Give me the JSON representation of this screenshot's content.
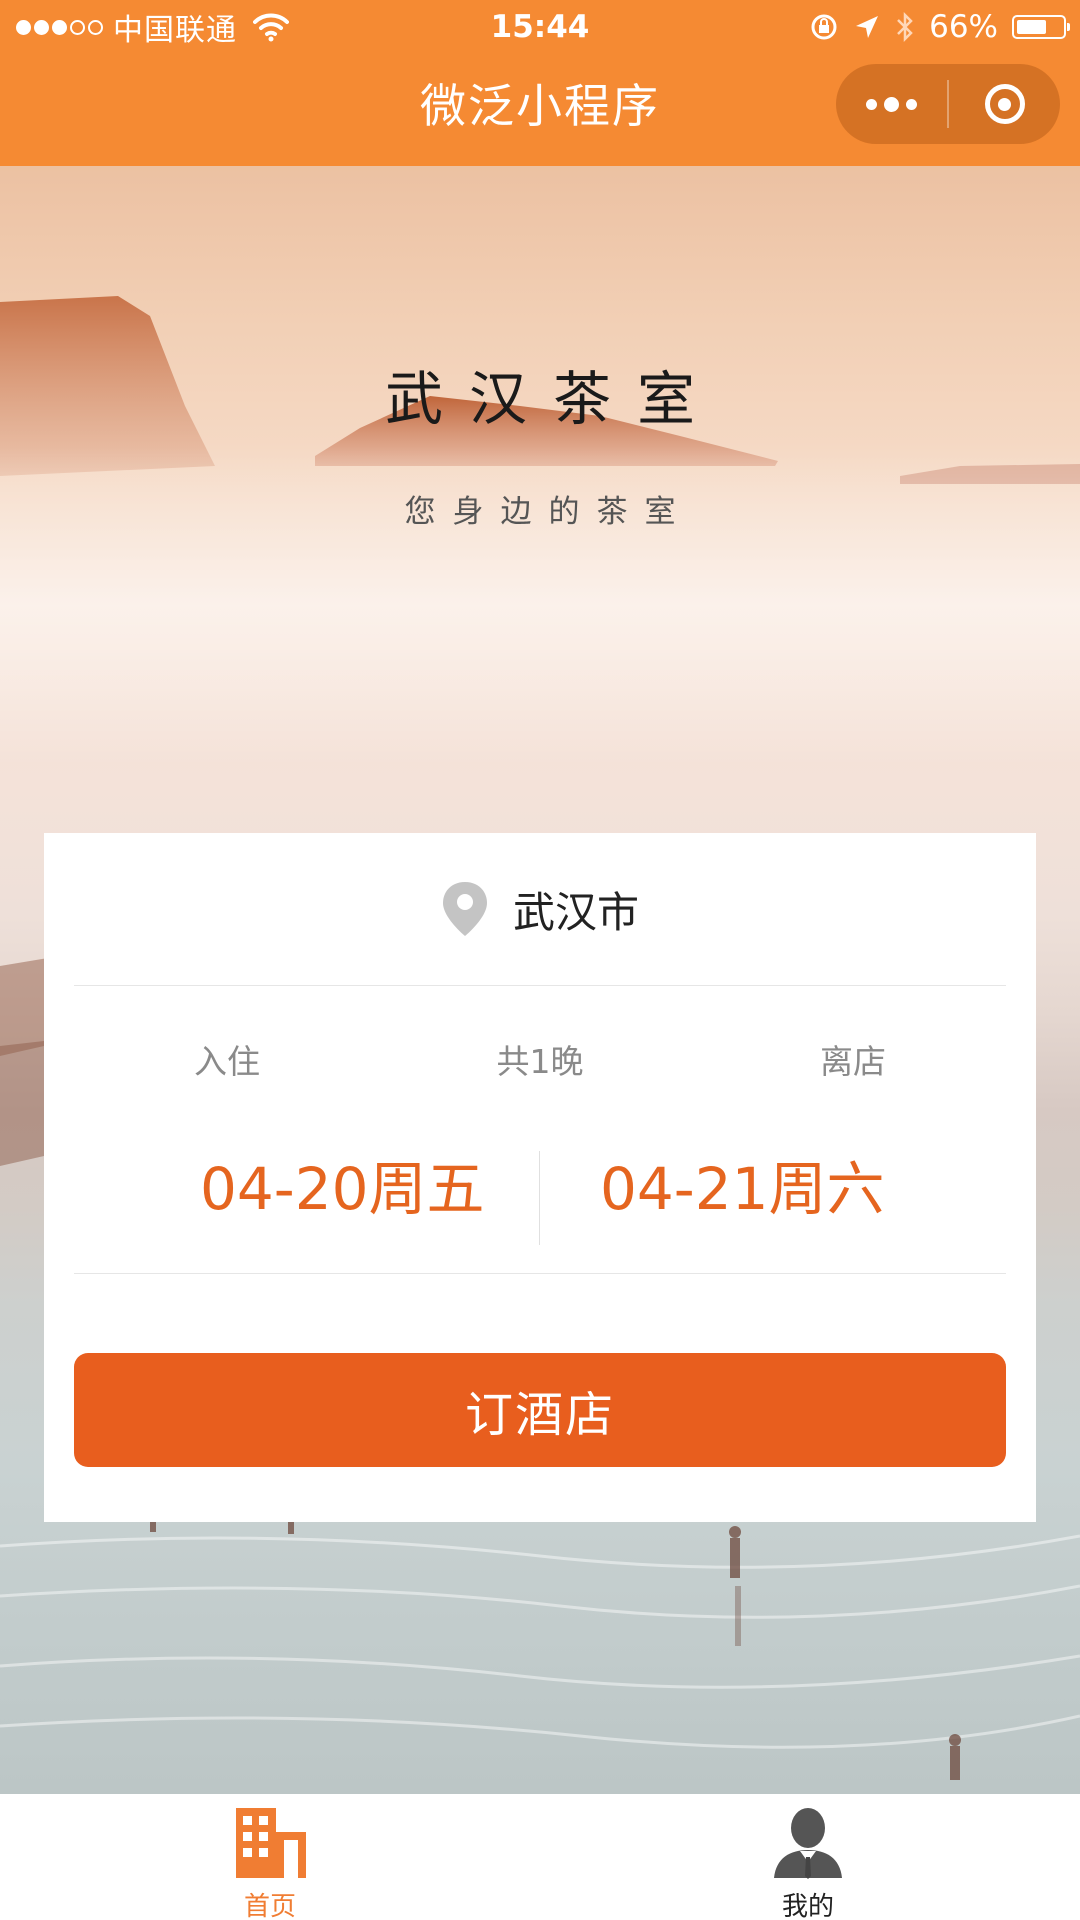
{
  "status_bar": {
    "carrier": "中国联通",
    "time": "15:44",
    "battery": "66%",
    "battery_level": 0.66
  },
  "nav": {
    "title": "微泛小程序"
  },
  "hero": {
    "title": "武汉茶室",
    "subtitle": "您身边的茶室"
  },
  "booking": {
    "city": "武汉市",
    "checkin_label": "入住",
    "nights_label": "共1晚",
    "checkout_label": "离店",
    "checkin_date": "04-20周五",
    "checkout_date": "04-21周六",
    "book_button": "订酒店"
  },
  "tabs": [
    {
      "label": "首页",
      "icon": "building-icon",
      "active": true
    },
    {
      "label": "我的",
      "icon": "user-icon",
      "active": false
    }
  ],
  "colors": {
    "primary": "#f58a33",
    "button": "#e85e1e",
    "date_text": "#e5651f"
  }
}
